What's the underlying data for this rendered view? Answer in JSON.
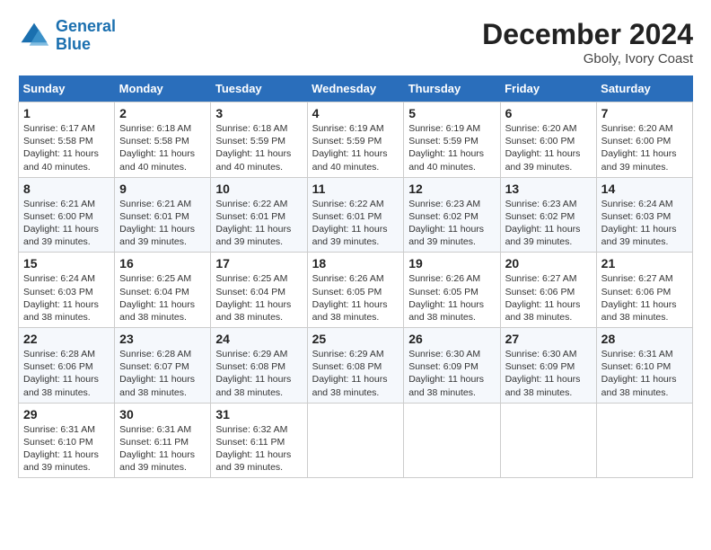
{
  "header": {
    "logo_line1": "General",
    "logo_line2": "Blue",
    "month": "December 2024",
    "location": "Gboly, Ivory Coast"
  },
  "weekdays": [
    "Sunday",
    "Monday",
    "Tuesday",
    "Wednesday",
    "Thursday",
    "Friday",
    "Saturday"
  ],
  "weeks": [
    [
      {
        "day": "1",
        "info": "Sunrise: 6:17 AM\nSunset: 5:58 PM\nDaylight: 11 hours and 40 minutes."
      },
      {
        "day": "2",
        "info": "Sunrise: 6:18 AM\nSunset: 5:58 PM\nDaylight: 11 hours and 40 minutes."
      },
      {
        "day": "3",
        "info": "Sunrise: 6:18 AM\nSunset: 5:59 PM\nDaylight: 11 hours and 40 minutes."
      },
      {
        "day": "4",
        "info": "Sunrise: 6:19 AM\nSunset: 5:59 PM\nDaylight: 11 hours and 40 minutes."
      },
      {
        "day": "5",
        "info": "Sunrise: 6:19 AM\nSunset: 5:59 PM\nDaylight: 11 hours and 40 minutes."
      },
      {
        "day": "6",
        "info": "Sunrise: 6:20 AM\nSunset: 6:00 PM\nDaylight: 11 hours and 39 minutes."
      },
      {
        "day": "7",
        "info": "Sunrise: 6:20 AM\nSunset: 6:00 PM\nDaylight: 11 hours and 39 minutes."
      }
    ],
    [
      {
        "day": "8",
        "info": "Sunrise: 6:21 AM\nSunset: 6:00 PM\nDaylight: 11 hours and 39 minutes."
      },
      {
        "day": "9",
        "info": "Sunrise: 6:21 AM\nSunset: 6:01 PM\nDaylight: 11 hours and 39 minutes."
      },
      {
        "day": "10",
        "info": "Sunrise: 6:22 AM\nSunset: 6:01 PM\nDaylight: 11 hours and 39 minutes."
      },
      {
        "day": "11",
        "info": "Sunrise: 6:22 AM\nSunset: 6:01 PM\nDaylight: 11 hours and 39 minutes."
      },
      {
        "day": "12",
        "info": "Sunrise: 6:23 AM\nSunset: 6:02 PM\nDaylight: 11 hours and 39 minutes."
      },
      {
        "day": "13",
        "info": "Sunrise: 6:23 AM\nSunset: 6:02 PM\nDaylight: 11 hours and 39 minutes."
      },
      {
        "day": "14",
        "info": "Sunrise: 6:24 AM\nSunset: 6:03 PM\nDaylight: 11 hours and 39 minutes."
      }
    ],
    [
      {
        "day": "15",
        "info": "Sunrise: 6:24 AM\nSunset: 6:03 PM\nDaylight: 11 hours and 38 minutes."
      },
      {
        "day": "16",
        "info": "Sunrise: 6:25 AM\nSunset: 6:04 PM\nDaylight: 11 hours and 38 minutes."
      },
      {
        "day": "17",
        "info": "Sunrise: 6:25 AM\nSunset: 6:04 PM\nDaylight: 11 hours and 38 minutes."
      },
      {
        "day": "18",
        "info": "Sunrise: 6:26 AM\nSunset: 6:05 PM\nDaylight: 11 hours and 38 minutes."
      },
      {
        "day": "19",
        "info": "Sunrise: 6:26 AM\nSunset: 6:05 PM\nDaylight: 11 hours and 38 minutes."
      },
      {
        "day": "20",
        "info": "Sunrise: 6:27 AM\nSunset: 6:06 PM\nDaylight: 11 hours and 38 minutes."
      },
      {
        "day": "21",
        "info": "Sunrise: 6:27 AM\nSunset: 6:06 PM\nDaylight: 11 hours and 38 minutes."
      }
    ],
    [
      {
        "day": "22",
        "info": "Sunrise: 6:28 AM\nSunset: 6:06 PM\nDaylight: 11 hours and 38 minutes."
      },
      {
        "day": "23",
        "info": "Sunrise: 6:28 AM\nSunset: 6:07 PM\nDaylight: 11 hours and 38 minutes."
      },
      {
        "day": "24",
        "info": "Sunrise: 6:29 AM\nSunset: 6:08 PM\nDaylight: 11 hours and 38 minutes."
      },
      {
        "day": "25",
        "info": "Sunrise: 6:29 AM\nSunset: 6:08 PM\nDaylight: 11 hours and 38 minutes."
      },
      {
        "day": "26",
        "info": "Sunrise: 6:30 AM\nSunset: 6:09 PM\nDaylight: 11 hours and 38 minutes."
      },
      {
        "day": "27",
        "info": "Sunrise: 6:30 AM\nSunset: 6:09 PM\nDaylight: 11 hours and 38 minutes."
      },
      {
        "day": "28",
        "info": "Sunrise: 6:31 AM\nSunset: 6:10 PM\nDaylight: 11 hours and 38 minutes."
      }
    ],
    [
      {
        "day": "29",
        "info": "Sunrise: 6:31 AM\nSunset: 6:10 PM\nDaylight: 11 hours and 39 minutes."
      },
      {
        "day": "30",
        "info": "Sunrise: 6:31 AM\nSunset: 6:11 PM\nDaylight: 11 hours and 39 minutes."
      },
      {
        "day": "31",
        "info": "Sunrise: 6:32 AM\nSunset: 6:11 PM\nDaylight: 11 hours and 39 minutes."
      },
      null,
      null,
      null,
      null
    ]
  ]
}
